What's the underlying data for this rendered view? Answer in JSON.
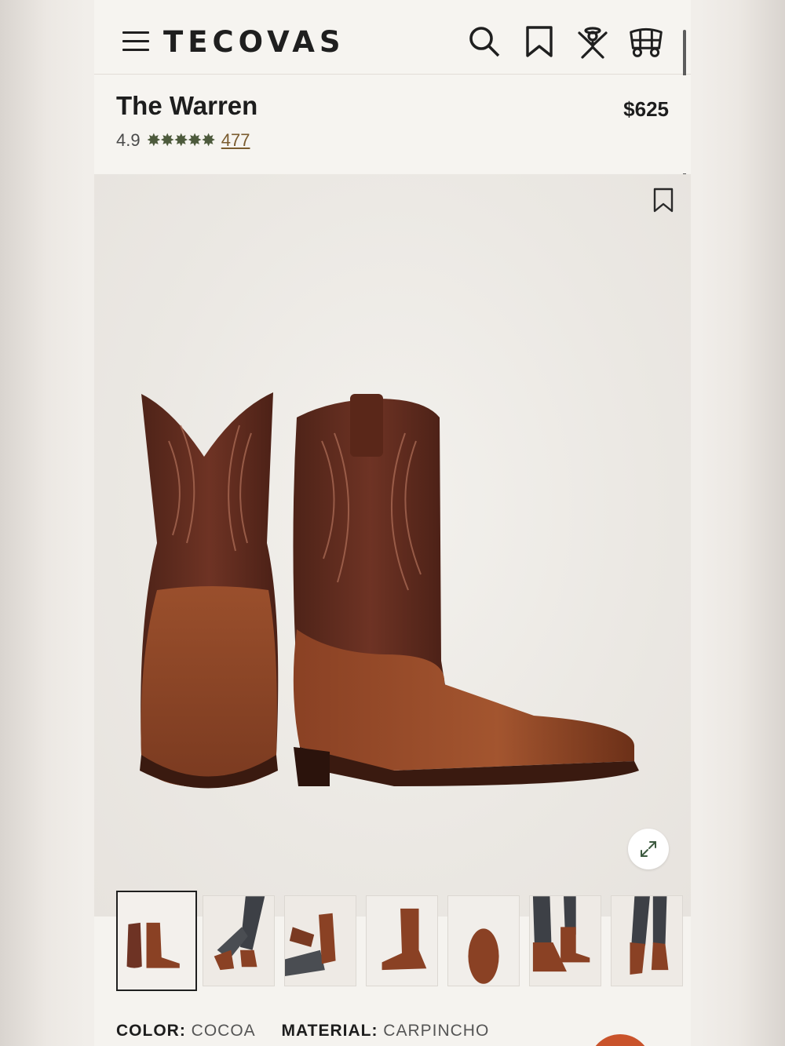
{
  "header": {
    "brand": "TECOVAS",
    "menu_icon": "hamburger-menu-icon",
    "icons": [
      "search-icon",
      "bookmark-icon",
      "account-icon",
      "cart-wagon-icon"
    ]
  },
  "product": {
    "name": "The Warren",
    "price": "$625",
    "rating": "4.9",
    "stars": "✸✸✸✸✸",
    "star_count": 5,
    "review_count": "477"
  },
  "gallery": {
    "bookmark_icon": "bookmark-icon",
    "expand_icon": "expand-icon",
    "thumbnail_count": 7,
    "active_thumbnail": 1
  },
  "specs": {
    "color_label": "COLOR:",
    "color_value": "COCOA",
    "material_label": "MATERIAL:",
    "material_value": "CARPINCHO"
  },
  "colors": {
    "accent_fab": "#c9532b",
    "star_color": "#4d5a3c",
    "review_link": "#7a5b2e",
    "boot_leather": "#7a3a22"
  }
}
